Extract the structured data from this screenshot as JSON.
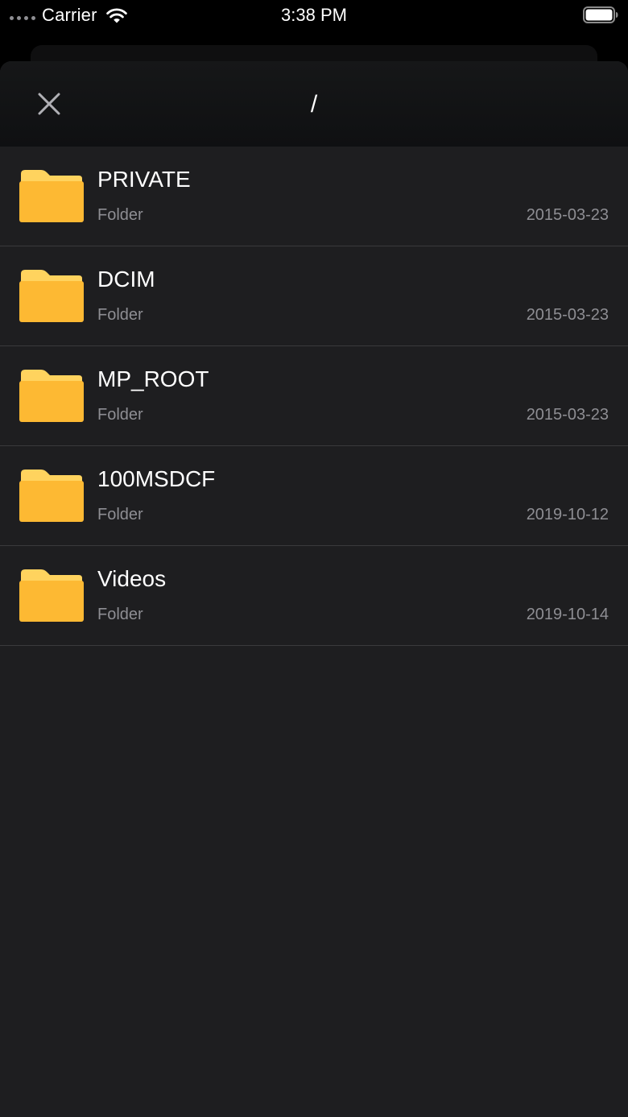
{
  "status_bar": {
    "carrier": "Carrier",
    "time": "3:38 PM",
    "icons": [
      "signal-icon",
      "wifi-icon",
      "battery-icon"
    ]
  },
  "header": {
    "close_icon": "close-icon",
    "path": "/"
  },
  "files": [
    {
      "name": "PRIVATE",
      "kind": "Folder",
      "date": "2015-03-23",
      "icon": "folder-icon"
    },
    {
      "name": "DCIM",
      "kind": "Folder",
      "date": "2015-03-23",
      "icon": "folder-icon"
    },
    {
      "name": "MP_ROOT",
      "kind": "Folder",
      "date": "2015-03-23",
      "icon": "folder-icon"
    },
    {
      "name": "100MSDCF",
      "kind": "Folder",
      "date": "2019-10-12",
      "icon": "folder-icon"
    },
    {
      "name": "Videos",
      "kind": "Folder",
      "date": "2019-10-14",
      "icon": "folder-icon"
    }
  ],
  "colors": {
    "background": "#1e1e20",
    "header": "#131416",
    "separator": "#3a3a3c",
    "folder_body": "#fdb933",
    "folder_tab": "#ffd35e",
    "secondary_text": "#8e8e93"
  }
}
